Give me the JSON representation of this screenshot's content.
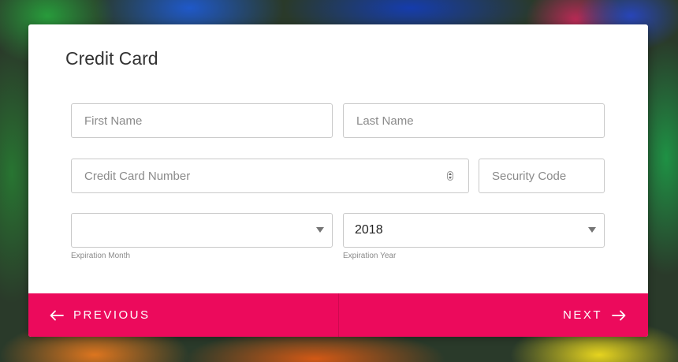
{
  "form": {
    "title": "Credit Card",
    "first_name_placeholder": "First Name",
    "last_name_placeholder": "Last Name",
    "card_number_placeholder": "Credit Card Number",
    "security_code_placeholder": "Security Code",
    "expiration_month": {
      "value": "",
      "helper": "Expiration Month"
    },
    "expiration_year": {
      "value": "2018",
      "helper": "Expiration Year"
    }
  },
  "footer": {
    "previous_label": "PREVIOUS",
    "next_label": "NEXT",
    "accent_color": "#ec0a5c"
  },
  "icons": {
    "previous": "arrow-left-icon",
    "next": "arrow-right-icon",
    "dropdown": "caret-down-icon",
    "spinner": "number-spinner-icon"
  }
}
